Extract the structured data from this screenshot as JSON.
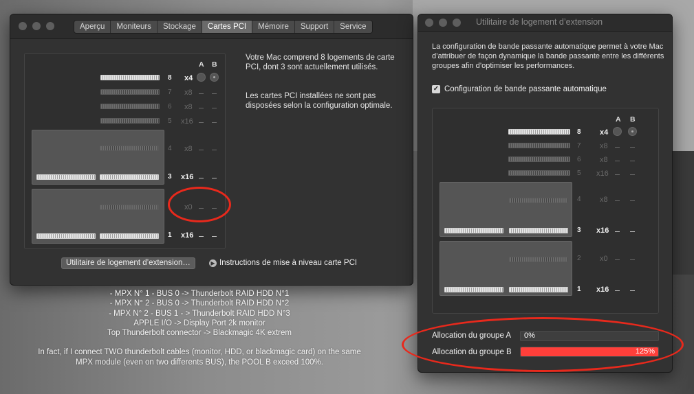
{
  "system_info_window": {
    "tabs": [
      "Aperçu",
      "Moniteurs",
      "Stockage",
      "Cartes PCI",
      "Mémoire",
      "Support",
      "Service"
    ],
    "active_tab": "Cartes PCI",
    "group_headers": {
      "a": "A",
      "b": "B"
    },
    "slots": [
      {
        "number": "8",
        "lanes": "x4"
      },
      {
        "number": "7",
        "lanes": "x8"
      },
      {
        "number": "6",
        "lanes": "x8"
      },
      {
        "number": "5",
        "lanes": "x16"
      },
      {
        "number": "4",
        "lanes": "x8"
      },
      {
        "number": "3",
        "lanes": "x16"
      },
      {
        "number": "",
        "lanes": "x0"
      },
      {
        "number": "1",
        "lanes": "x16"
      }
    ],
    "info_paragraph_1": "Votre Mac comprend 8 logements de carte PCI, dont 3 sont actuellement utilisés.",
    "info_paragraph_2": "Les cartes PCI installées ne sont pas disposées selon la configuration optimale.",
    "expansion_button_label": "Utilitaire de logement d’extension…",
    "upgrade_link_label": "Instructions de mise à niveau carte PCI"
  },
  "notes": {
    "lines": [
      "- MPX N° 1 - BUS 0 -> Thunderbolt RAID HDD N°1",
      "- MPX N° 2 - BUS 0 -> Thunderbolt RAID HDD N°2",
      "- MPX N° 2 - BUS 1 - > Thunderbolt RAID HDD N°3",
      "APPLE I/O -> Display Port 2k monitor",
      "Top Thunderbolt connector -> Blackmagic 4K extrem"
    ],
    "paragraph_line_1": "In fact, if I connect TWO thunderbolt cables (monitor, HDD, or blackmagic card) on the same",
    "paragraph_line_2": "MPX module (even on two differents BUS), the POOL B exceed 100%."
  },
  "expansion_utility_window": {
    "title": "Utilitaire de logement d’extension",
    "description": "La configuration de bande passante automatique permet à votre Mac d’attribuer de façon dynamique la bande passante entre les différents groupes afin d’optimiser les performances.",
    "auto_config_label": "Configuration de bande passante automatique",
    "auto_config_checked": true,
    "group_headers": {
      "a": "A",
      "b": "B"
    },
    "slots": [
      {
        "number": "8",
        "lanes": "x4"
      },
      {
        "number": "7",
        "lanes": "x8"
      },
      {
        "number": "6",
        "lanes": "x8"
      },
      {
        "number": "5",
        "lanes": "x16"
      },
      {
        "number": "4",
        "lanes": "x8"
      },
      {
        "number": "3",
        "lanes": "x16"
      },
      {
        "number": "2",
        "lanes": "x0"
      },
      {
        "number": "1",
        "lanes": "x16"
      }
    ],
    "allocation": [
      {
        "label": "Allocation du groupe A",
        "value": "0%",
        "fraction": 0.0
      },
      {
        "label": "Allocation du groupe B",
        "value": "125%",
        "fraction": 1.0
      }
    ],
    "colors": {
      "over_allocation": "#ff3f3a",
      "annotation_circle": "#e8291c"
    }
  }
}
